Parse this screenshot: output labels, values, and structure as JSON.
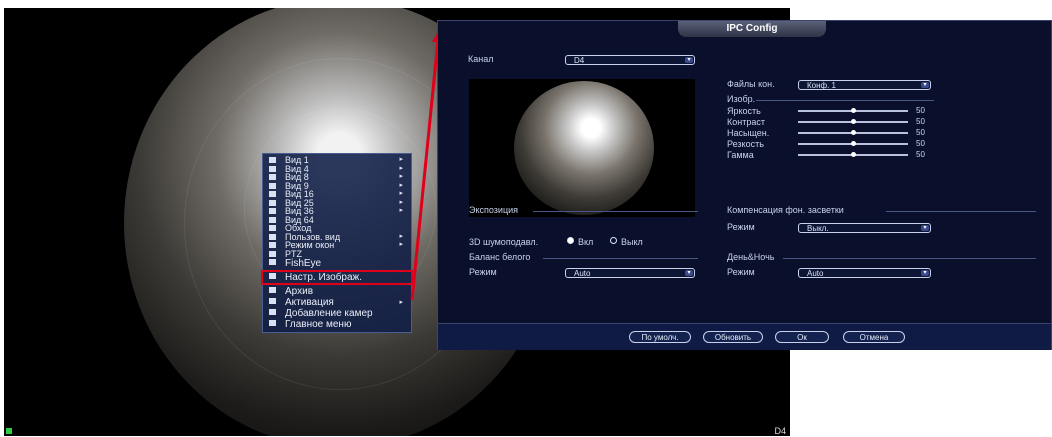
{
  "live": {
    "channel_label": "D4"
  },
  "menu": {
    "items": [
      {
        "label": "Вид 1",
        "submenu": true
      },
      {
        "label": "Вид 4",
        "submenu": true
      },
      {
        "label": "Вид 8",
        "submenu": true
      },
      {
        "label": "Вид 9",
        "submenu": true
      },
      {
        "label": "Вид 16",
        "submenu": true
      },
      {
        "label": "Вид 25",
        "submenu": true
      },
      {
        "label": "Вид 36",
        "submenu": true
      },
      {
        "label": "Вид 64",
        "submenu": false
      },
      {
        "label": "Обход",
        "submenu": false
      },
      {
        "label": "Пользов. вид",
        "submenu": true
      },
      {
        "label": "Режим окон",
        "submenu": true
      },
      {
        "label": "PTZ",
        "submenu": false
      },
      {
        "label": "FishEye",
        "submenu": false
      },
      {
        "label": "Настр. Изображ.",
        "submenu": false,
        "selected": true
      },
      {
        "label": "Архив",
        "submenu": false
      },
      {
        "label": "Активация",
        "submenu": true
      },
      {
        "label": "Добавление камер",
        "submenu": false
      },
      {
        "label": "Главное меню",
        "submenu": false
      }
    ]
  },
  "dialog": {
    "title": "IPC Config",
    "channel_label": "Канал",
    "channel_value": "D4",
    "config_file_label": "Файлы кон.",
    "config_file_value": "Конф. 1",
    "image_section": "Изобр.",
    "sliders": [
      {
        "label": "Яркость",
        "value": "50"
      },
      {
        "label": "Контраст",
        "value": "50"
      },
      {
        "label": "Насыщен.",
        "value": "50"
      },
      {
        "label": "Резкость",
        "value": "50"
      },
      {
        "label": "Гамма",
        "value": "50"
      }
    ],
    "exposure_section": "Экспозиция",
    "backlight_section": "Компенсация фон. засветки",
    "backlight_mode_label": "Режим",
    "backlight_mode_value": "Выкл.",
    "noise_label": "3D шумоподавл.",
    "noise_on": "Вкл",
    "noise_off": "Выкл",
    "wb_section": "Баланс белого",
    "wb_mode_label": "Режим",
    "wb_mode_value": "Auto",
    "daynight_section": "День&Ночь",
    "daynight_mode_label": "Режим",
    "daynight_mode_value": "Auto",
    "buttons": {
      "default": "По умолч.",
      "refresh": "Обновить",
      "ok": "Ок",
      "cancel": "Отмена"
    }
  }
}
